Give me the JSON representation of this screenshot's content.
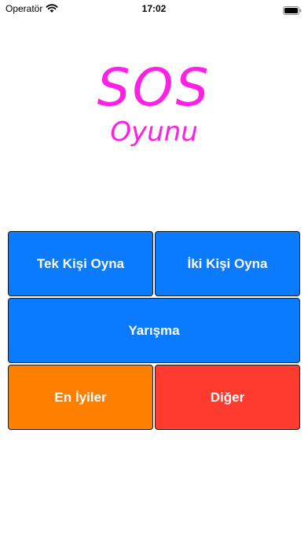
{
  "status_bar": {
    "carrier": "Operatör",
    "time": "17:02"
  },
  "title": {
    "main": "SOS",
    "sub": "Oyunu"
  },
  "buttons": {
    "single_player": "Tek Kişi Oyna",
    "two_player": "İki Kişi Oyna",
    "contest": "Yarışma",
    "leaderboard": "En İyiler",
    "other": "Diğer"
  },
  "colors": {
    "title": "#ff1fe6",
    "blue": "#0a7bff",
    "orange": "#ff8000",
    "red": "#ff3b30"
  },
  "icons": {
    "wifi": "wifi-icon",
    "battery": "battery-icon"
  }
}
